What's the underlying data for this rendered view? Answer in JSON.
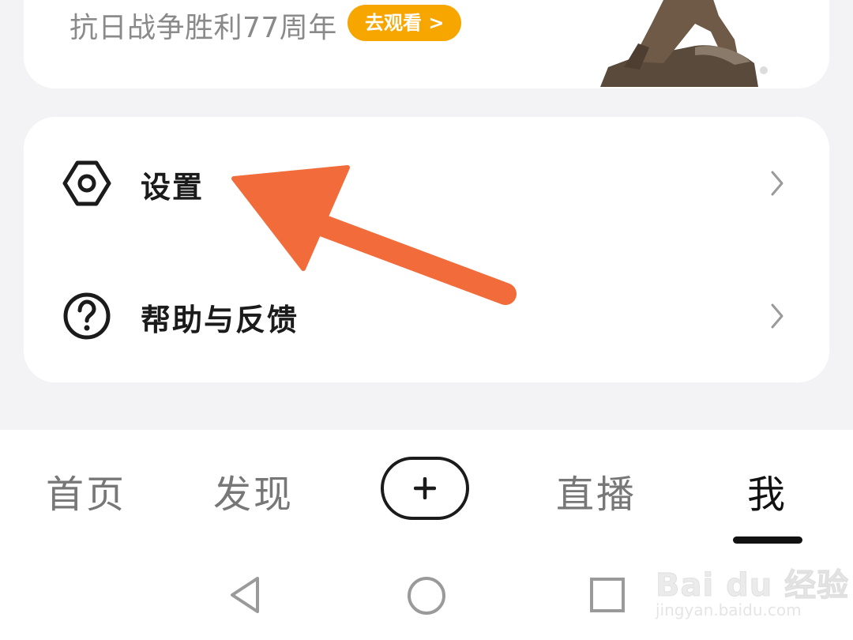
{
  "banner": {
    "text": "抗日战争胜利77周年",
    "button_label": "去观看 >",
    "button_color": "#f7a600"
  },
  "menu": {
    "items": [
      {
        "label": "设置",
        "icon": "hexagon-gear-icon"
      },
      {
        "label": "帮助与反馈",
        "icon": "question-circle-icon"
      }
    ]
  },
  "annotation": {
    "color": "#f26b3a",
    "icon": "pointer-arrow"
  },
  "tabbar": {
    "tabs": [
      {
        "label": "首页"
      },
      {
        "label": "发现"
      },
      {
        "label": "+"
      },
      {
        "label": "直播"
      },
      {
        "label": "我",
        "active": true
      }
    ]
  },
  "system_nav": {
    "buttons": [
      "back-icon",
      "home-icon",
      "recents-icon"
    ]
  },
  "watermark": {
    "main": "Bai du 经验",
    "sub": "jingyan.baidu.com"
  }
}
